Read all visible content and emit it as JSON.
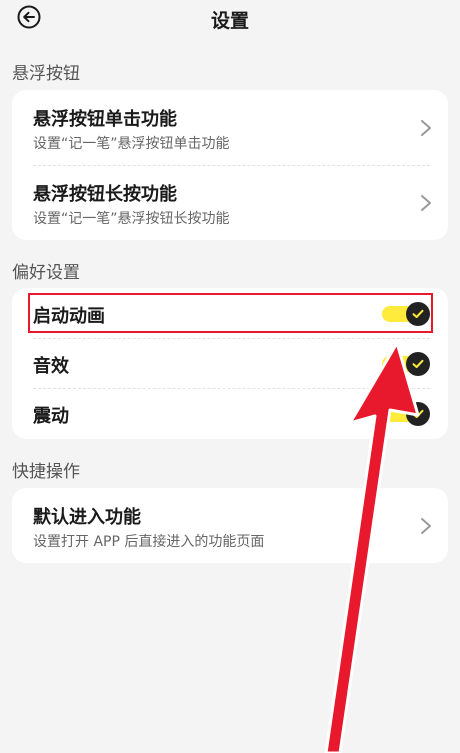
{
  "header": {
    "title": "设置"
  },
  "sections": [
    {
      "title": "悬浮按钮",
      "items": [
        {
          "title": "悬浮按钮单击功能",
          "subtitle": "设置“记一笔”悬浮按钮单击功能"
        },
        {
          "title": "悬浮按钮长按功能",
          "subtitle": "设置“记一笔”悬浮按钮长按功能"
        }
      ]
    },
    {
      "title": "偏好设置",
      "items": [
        {
          "title": "启动动画",
          "toggle_on": true
        },
        {
          "title": "音效",
          "toggle_on": true
        },
        {
          "title": "震动",
          "toggle_on": true
        }
      ]
    },
    {
      "title": "快捷操作",
      "items": [
        {
          "title": "默认进入功能",
          "subtitle": "设置打开 APP 后直接进入的功能页面"
        }
      ]
    }
  ],
  "colors": {
    "toggle_track": "#ffeb3b",
    "toggle_knob": "#222222",
    "annotation_red": "#e8192c"
  },
  "icons": {
    "back": "back-arrow-icon",
    "chevron": "chevron-right-icon",
    "check": "check-icon"
  }
}
